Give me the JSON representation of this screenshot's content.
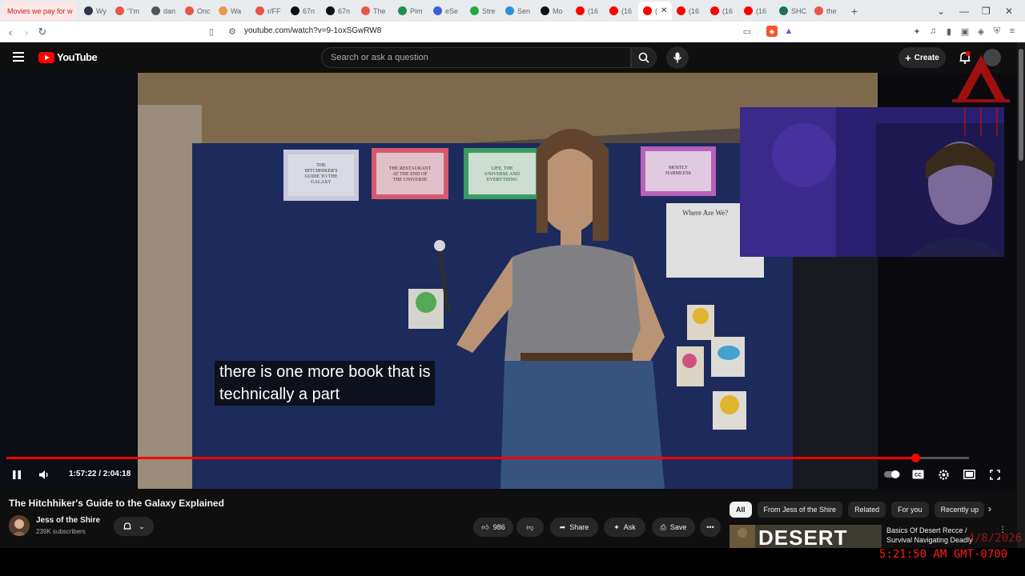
{
  "browser": {
    "tabs": [
      {
        "label": "Movies we pay for w",
        "color": "#ffffff"
      },
      {
        "label": "Wy",
        "color": "#2d3748"
      },
      {
        "label": "\"I'm",
        "color": "#e8564a"
      },
      {
        "label": "dan",
        "color": "#555555"
      },
      {
        "label": "Onc",
        "color": "#e8564a"
      },
      {
        "label": "Wa",
        "color": "#e89b4a"
      },
      {
        "label": "r/FF",
        "color": "#e8564a"
      },
      {
        "label": "67n",
        "color": "#111111"
      },
      {
        "label": "67n",
        "color": "#111111"
      },
      {
        "label": "The",
        "color": "#e8564a"
      },
      {
        "label": "Pim",
        "color": "#1f8f4e"
      },
      {
        "label": "eSe",
        "color": "#3b5fd6"
      },
      {
        "label": "Stre",
        "color": "#1faa3c"
      },
      {
        "label": "Sen",
        "color": "#2e8fd6"
      },
      {
        "label": "Mo",
        "color": "#111111"
      },
      {
        "label": "(16",
        "color": "#ff0000"
      },
      {
        "label": "(16",
        "color": "#ff0000"
      },
      {
        "label": "(",
        "color": "#ff0000"
      },
      {
        "label": "(16",
        "color": "#ff0000"
      },
      {
        "label": "(16",
        "color": "#ff0000"
      },
      {
        "label": "(16",
        "color": "#ff0000"
      },
      {
        "label": "SHC",
        "color": "#1f6f5f"
      },
      {
        "label": "the",
        "color": "#e8564a"
      }
    ],
    "url": "youtube.com/watch?v=9-1oxSGwRW8"
  },
  "header": {
    "logo_text": "YouTube",
    "search_placeholder": "Search or ask a question",
    "create_label": "Create"
  },
  "player": {
    "subtitle": "there is one more book that is\ntechnically a part",
    "time": "1:57:22 / 2:04:18",
    "progress_fraction": 0.9443,
    "book_cards": [
      "THE\nHITCHHIKER'S\nGUIDE TO THE\nGALAXY",
      "THE RESTAURANT\nAT THE END OF\nTHE UNIVERSE",
      "LIFE, THE\nUNIVERSE AND\nEVERYTHING",
      "MOSTLY\nHARMLESS"
    ],
    "board_note": "Where Are We?"
  },
  "video": {
    "title": "The Hitchhiker's Guide to the Galaxy Explained",
    "channel": "Jess of the Shire",
    "subscribers": "239K subscribers",
    "likes": "986",
    "share_label": "Share",
    "ask_label": "Ask",
    "save_label": "Save"
  },
  "sidebar": {
    "chips": [
      "All",
      "From Jess of the Shire",
      "Related",
      "For you",
      "Recently up"
    ],
    "rec_title": "Basics Of Desert Recce / Survival Navigating Deadly",
    "rec_thumb_text": "DESERT"
  },
  "overlay": {
    "date_partial": "4/8/2026",
    "time": "5:21:50 AM GMT-0700"
  },
  "colors": {
    "accent": "#ff0000",
    "background": "#0f0f0f",
    "chip_bg": "#272727"
  }
}
